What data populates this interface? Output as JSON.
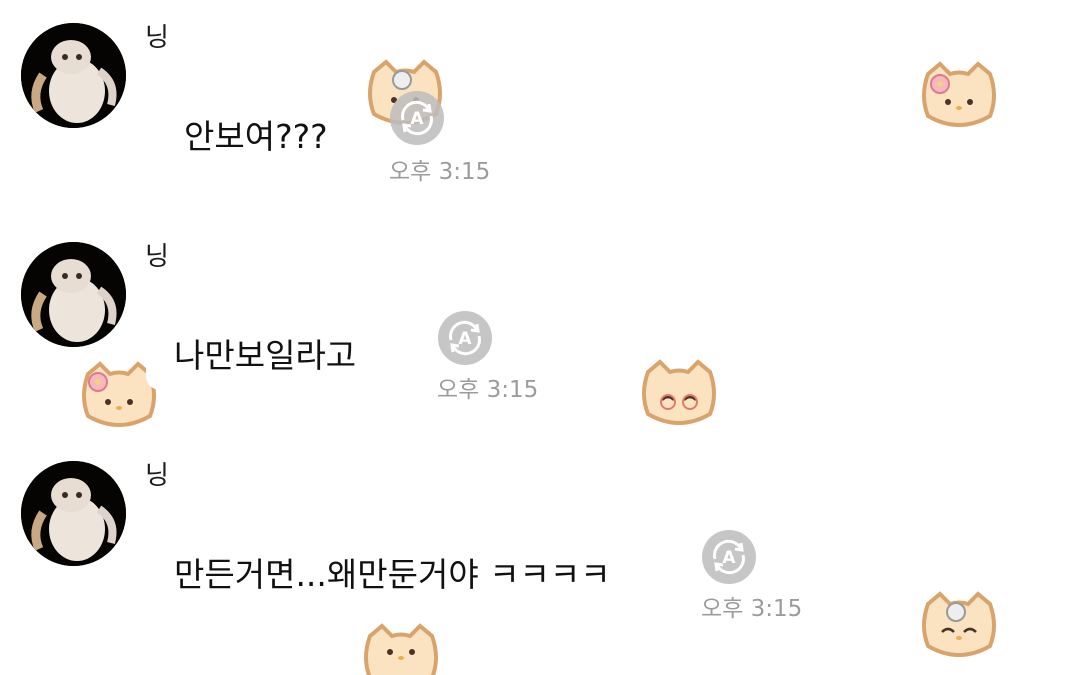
{
  "messages": [
    {
      "sender": "닝",
      "text": "안보여???",
      "time": "오후 3:15",
      "translate_icon": "translate-a-icon"
    },
    {
      "sender": "닝",
      "text": "나만보일라고",
      "time": "오후 3:15",
      "translate_icon": "translate-a-icon"
    },
    {
      "sender": "닝",
      "text": "만든거면...왜만둔거야 ㅋㅋㅋㅋ",
      "time": "오후 3:15",
      "translate_icon": "translate-a-icon"
    }
  ],
  "background": {
    "sticker_icon": "kitty-face-icon",
    "colors": {
      "outline": "#d9a46c",
      "face": "#fbe3c2",
      "bow": "#f6b7c0",
      "eyes": "#4a3226"
    }
  },
  "colors": {
    "time": "#9c9c9c",
    "translate_icon": "#bcbcbc",
    "avatar_bg": "#050403"
  }
}
